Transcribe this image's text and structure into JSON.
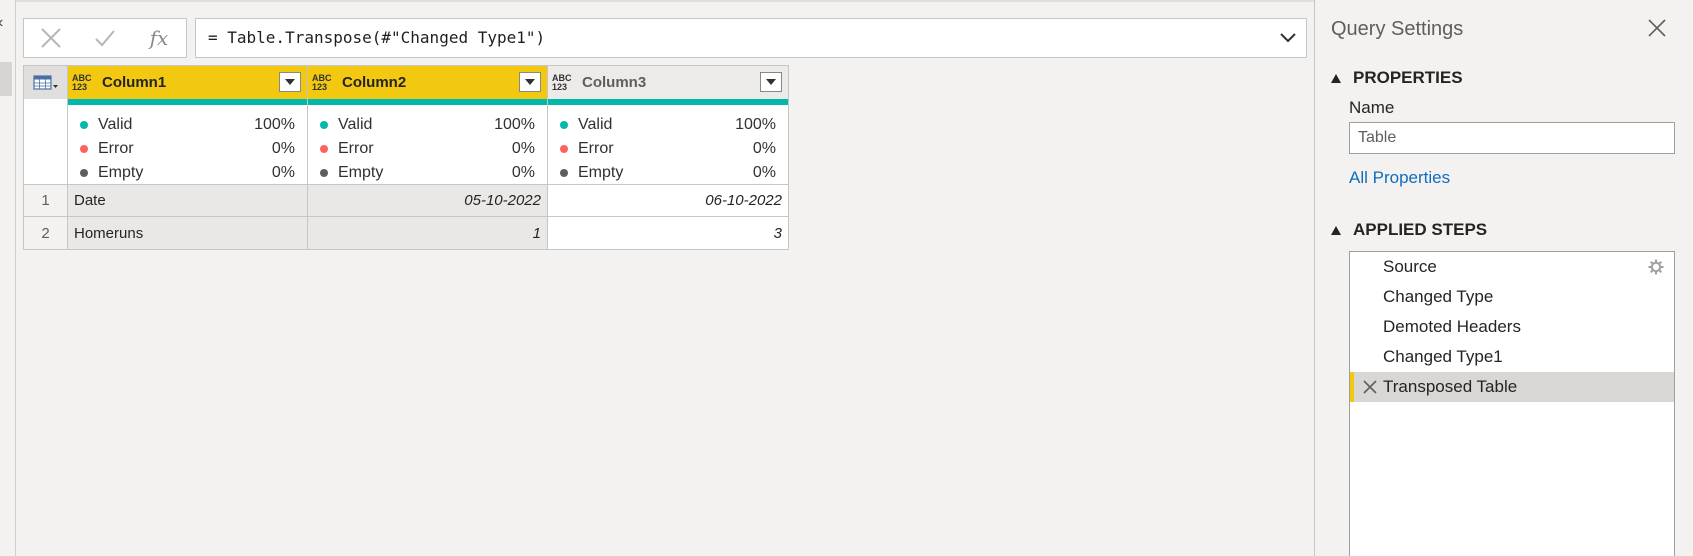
{
  "formula": {
    "cancel_icon": "close-icon",
    "commit_icon": "check-icon",
    "fx_label": "fx",
    "expression": "= Table.Transpose(#\"Changed Type1\")"
  },
  "grid": {
    "type_label_top": "ABC",
    "type_label_bottom": "123",
    "columns": [
      {
        "name": "Column1",
        "valid_label": "Valid",
        "valid_pct": "100%",
        "error_label": "Error",
        "error_pct": "0%",
        "empty_label": "Empty",
        "empty_pct": "0%"
      },
      {
        "name": "Column2",
        "valid_label": "Valid",
        "valid_pct": "100%",
        "error_label": "Error",
        "error_pct": "0%",
        "empty_label": "Empty",
        "empty_pct": "0%"
      },
      {
        "name": "Column3",
        "valid_label": "Valid",
        "valid_pct": "100%",
        "error_label": "Error",
        "error_pct": "0%",
        "empty_label": "Empty",
        "empty_pct": "0%"
      }
    ],
    "rows": [
      {
        "num": "1",
        "cells": [
          "Date",
          "05-10-2022",
          "06-10-2022"
        ]
      },
      {
        "num": "2",
        "cells": [
          "Homeruns",
          "1",
          "3"
        ]
      }
    ]
  },
  "panel": {
    "title": "Query Settings",
    "properties_header": "PROPERTIES",
    "name_label": "Name",
    "name_value": "Table",
    "all_properties": "All Properties",
    "applied_steps_header": "APPLIED STEPS",
    "steps": [
      "Source",
      "Changed Type",
      "Demoted Headers",
      "Changed Type1",
      "Transposed Table"
    ]
  },
  "colors": {
    "accent_yellow": "#f2c811",
    "valid_teal": "#01b8aa",
    "error_red": "#fd625e",
    "link_blue": "#0f6cbd"
  }
}
